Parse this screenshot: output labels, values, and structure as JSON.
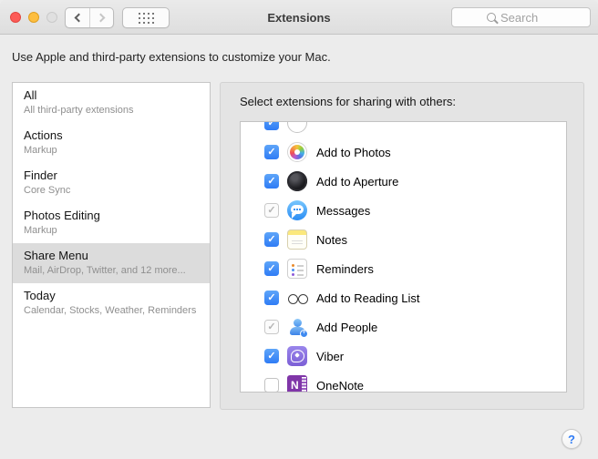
{
  "titlebar": {
    "title": "Extensions",
    "search_placeholder": "Search"
  },
  "intro": "Use Apple and third-party extensions to customize your Mac.",
  "sidebar": {
    "items": [
      {
        "title": "All",
        "subtitle": "All third-party extensions",
        "state": "normal"
      },
      {
        "title": "Actions",
        "subtitle": "Markup",
        "state": "normal"
      },
      {
        "title": "Finder",
        "subtitle": "Core Sync",
        "state": "normal"
      },
      {
        "title": "Photos Editing",
        "subtitle": "Markup",
        "state": "normal"
      },
      {
        "title": "Share Menu",
        "subtitle": "Mail, AirDrop, Twitter, and 12 more...",
        "state": "selected"
      },
      {
        "title": "Today",
        "subtitle": "Calendar, Stocks, Weather, Reminders",
        "state": "normal"
      }
    ]
  },
  "panel": {
    "header": "Select extensions for sharing with others:",
    "items": [
      {
        "label": "",
        "icon": "app-icon",
        "state": "checked"
      },
      {
        "label": "Add to Photos",
        "icon": "photos-icon",
        "state": "checked"
      },
      {
        "label": "Add to Aperture",
        "icon": "aperture-icon",
        "state": "checked"
      },
      {
        "label": "Messages",
        "icon": "messages-icon",
        "state": "checked-disabled"
      },
      {
        "label": "Notes",
        "icon": "notes-icon",
        "state": "checked"
      },
      {
        "label": "Reminders",
        "icon": "reminders-icon",
        "state": "checked"
      },
      {
        "label": "Add to Reading List",
        "icon": "reading-list-icon",
        "state": "checked"
      },
      {
        "label": "Add People",
        "icon": "add-people-icon",
        "state": "checked-disabled"
      },
      {
        "label": "Viber",
        "icon": "viber-icon",
        "state": "checked"
      },
      {
        "label": "OneNote",
        "icon": "onenote-icon",
        "state": "unchecked"
      }
    ]
  },
  "help_button_label": "?",
  "colors": {
    "checkbox_blue": "#3d86f7",
    "selected_row_grey": "#dcdcdc",
    "traffic_red": "#fc5b57",
    "traffic_yellow": "#fdbe40",
    "help_blue": "#2f7cf6"
  }
}
